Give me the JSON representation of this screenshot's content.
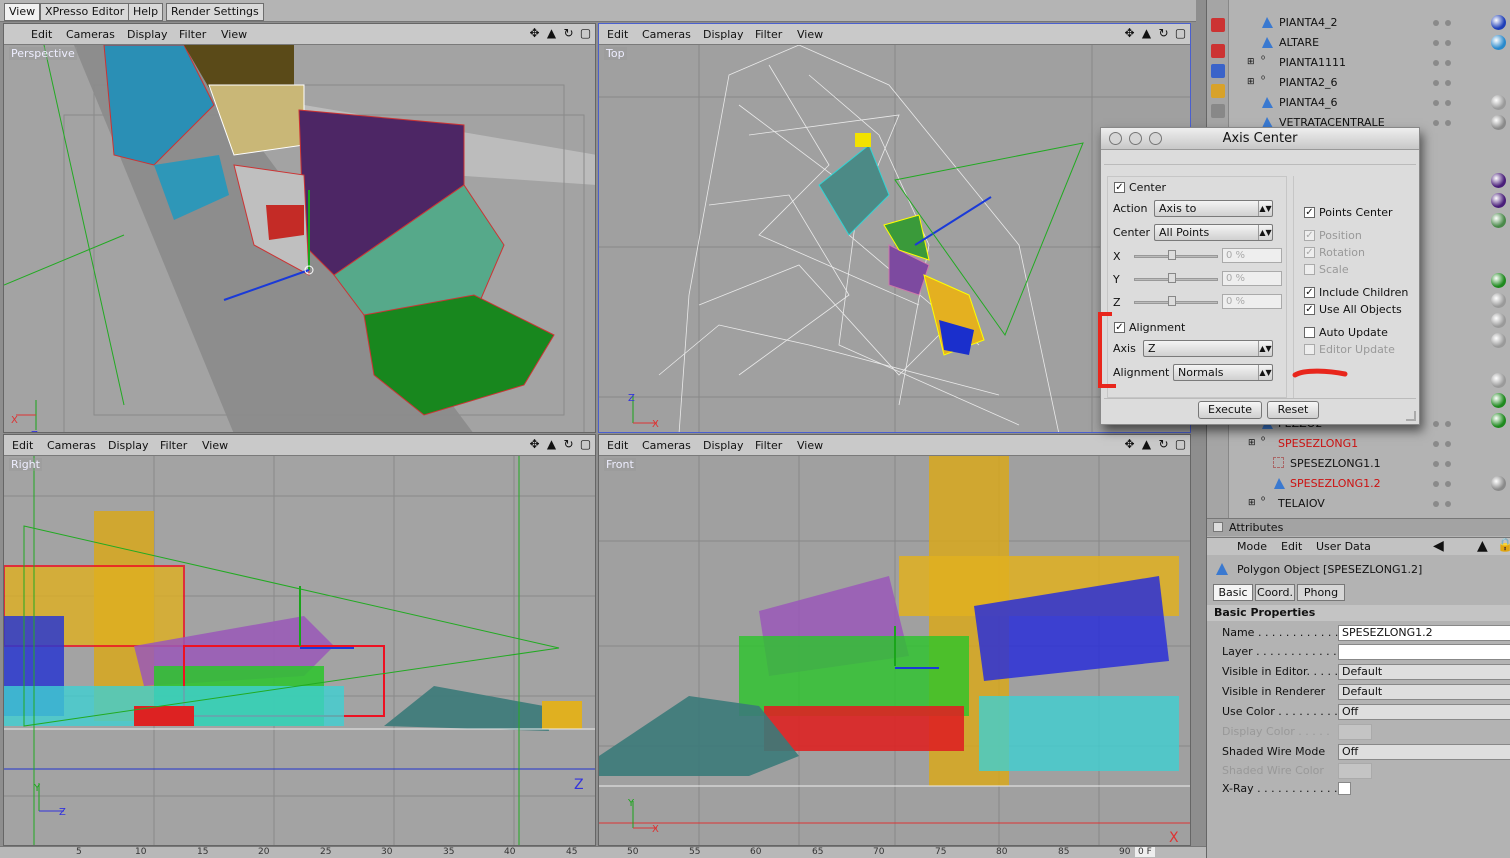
{
  "top_tabs": [
    {
      "label": "View"
    },
    {
      "label": "XPresso Editor"
    },
    {
      "label": "Help"
    },
    {
      "label": "Render Settings"
    }
  ],
  "viewport_menu": {
    "edit": "Edit",
    "cameras": "Cameras",
    "display": "Display",
    "filter": "Filter",
    "view": "View"
  },
  "viewports": {
    "perspective": {
      "label": "Perspective"
    },
    "top": {
      "label": "Top"
    },
    "right": {
      "label": "Right"
    },
    "front": {
      "label": "Front"
    }
  },
  "axis_letters": {
    "x": "X",
    "y": "Y",
    "z": "Z"
  },
  "ruler_ticks": [
    "5",
    "10",
    "15",
    "20",
    "25",
    "30",
    "35",
    "40",
    "45",
    "50",
    "55",
    "60",
    "65",
    "70",
    "75",
    "80",
    "85",
    "90"
  ],
  "ruler_field": "0 F",
  "objects": [
    {
      "name": "PIANTA4_2",
      "type": "poly",
      "ball": "#1f3fb8"
    },
    {
      "name": "ALTARE",
      "type": "poly",
      "ball": "#2a8acc"
    },
    {
      "name": "PIANTA1111",
      "type": "null",
      "ball": ""
    },
    {
      "name": "PIANTA2_6",
      "type": "null",
      "ball": ""
    },
    {
      "name": "PIANTA4_6",
      "type": "poly",
      "ball": "#9a9a9a"
    },
    {
      "name": "VETRATACENTRALE",
      "type": "poly",
      "ball": "#8a8a8a"
    }
  ],
  "objects_lower": [
    {
      "name": "PEZZO2",
      "type": "poly",
      "indent": 1,
      "ball": "",
      "red": false
    },
    {
      "name": "SPESEZLONG1",
      "type": "null",
      "indent": 1,
      "ball": "",
      "red": true
    },
    {
      "name": "SPESEZLONG1.1",
      "type": "wire",
      "indent": 2,
      "ball": "",
      "red": false
    },
    {
      "name": "SPESEZLONG1.2",
      "type": "poly",
      "indent": 2,
      "ball": "#8a8a8a",
      "red": true
    },
    {
      "name": "TELAIOV",
      "type": "null",
      "indent": 1,
      "ball": "",
      "red": false
    }
  ],
  "side_balls": [
    "#4a1f7a",
    "#4a1f7a",
    "#4a8a4a",
    "#1f8a1f",
    "#9a9a9a",
    "#9a9a9a",
    "#9a9a9a",
    "#9a9a9a",
    "#1f8a1f",
    "#1f8a1f"
  ],
  "attributes": {
    "title": "Attributes",
    "menu": {
      "mode": "Mode",
      "edit": "Edit",
      "user_data": "User Data"
    },
    "object_title": "Polygon Object [SPESEZLONG1.2]",
    "tabs": [
      "Basic",
      "Coord.",
      "Phong"
    ],
    "section": "Basic Properties",
    "fields": [
      {
        "label": "Name . . . . . . . . . . . . . .",
        "value": "SPESEZLONG1.2",
        "kind": "text",
        "disabled": false
      },
      {
        "label": "Layer . . . . . . . . . . . . . .",
        "value": "",
        "kind": "text",
        "disabled": false
      },
      {
        "label": "Visible in Editor. . . . .",
        "value": "Default",
        "kind": "drop",
        "disabled": false
      },
      {
        "label": "Visible in Renderer",
        "value": "Default",
        "kind": "drop",
        "disabled": false
      },
      {
        "label": "Use Color . . . . . . . . . .",
        "value": "Off",
        "kind": "drop",
        "disabled": false
      },
      {
        "label": "Display Color . . . . .",
        "value": "",
        "kind": "color",
        "disabled": true
      },
      {
        "label": "Shaded Wire Mode",
        "value": "Off",
        "kind": "drop",
        "disabled": false
      },
      {
        "label": "Shaded Wire Color",
        "value": "",
        "kind": "color",
        "disabled": true
      },
      {
        "label": "X-Ray . . . . . . . . . . . . .",
        "value": "",
        "kind": "check",
        "disabled": false
      }
    ]
  },
  "dialog": {
    "title": "Axis Center",
    "center": {
      "label": "Center",
      "checked": true
    },
    "action": {
      "label": "Action",
      "value": "Axis to"
    },
    "center_mode": {
      "label": "Center",
      "value": "All Points"
    },
    "axes": [
      {
        "label": "X",
        "value": "0 %"
      },
      {
        "label": "Y",
        "value": "0 %"
      },
      {
        "label": "Z",
        "value": "0 %"
      }
    ],
    "alignment": {
      "label": "Alignment",
      "checked": true
    },
    "axis": {
      "label": "Axis",
      "value": "Z"
    },
    "alignment_mode": {
      "label": "Alignment",
      "value": "Normals"
    },
    "right_options": [
      {
        "label": "Points Center",
        "checked": true,
        "disabled": false
      },
      {
        "label": "Position",
        "checked": true,
        "disabled": true
      },
      {
        "label": "Rotation",
        "checked": true,
        "disabled": true
      },
      {
        "label": "Scale",
        "checked": false,
        "disabled": true
      },
      {
        "label": "Include Children",
        "checked": true,
        "disabled": false
      },
      {
        "label": "Use All Objects",
        "checked": true,
        "disabled": false
      },
      {
        "label": "Auto Update",
        "checked": false,
        "disabled": false
      },
      {
        "label": "Editor Update",
        "checked": false,
        "disabled": true
      }
    ],
    "execute": "Execute",
    "reset": "Reset"
  },
  "colors": {
    "annotation": "#e8261c",
    "accent_selected": "#cc1111"
  }
}
